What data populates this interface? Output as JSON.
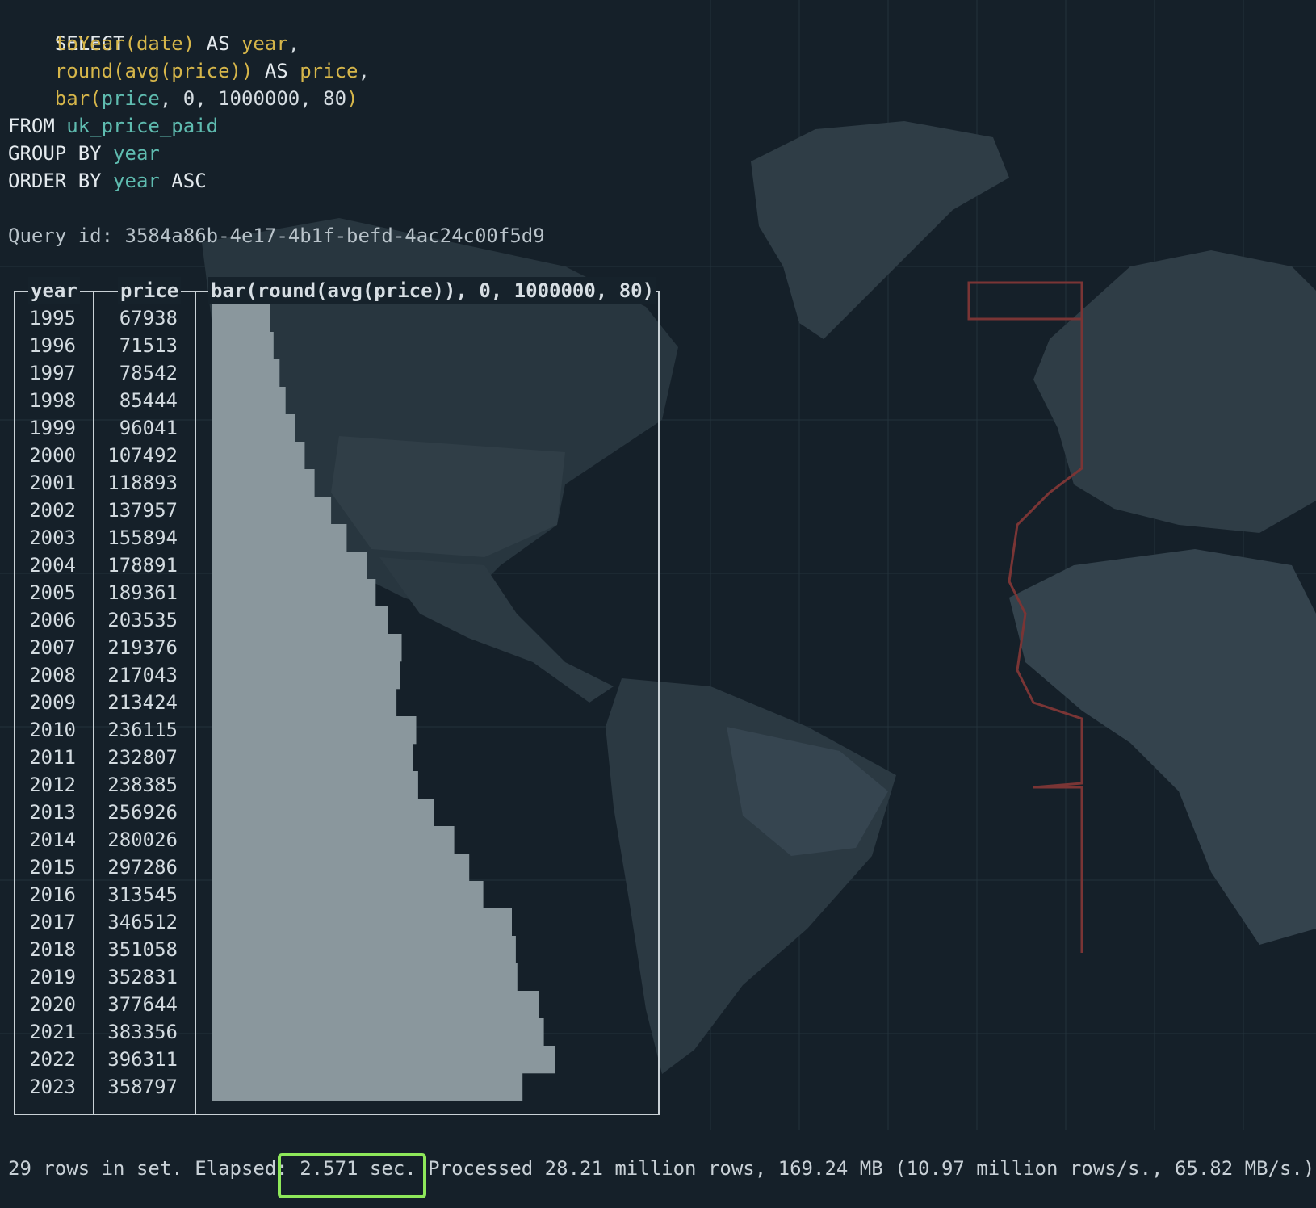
{
  "query": {
    "line1_kw": "SELECT",
    "line2_fn": "toYear(date)",
    "line2_kw": " AS ",
    "line2_id": "year",
    "line2_tail": ",",
    "line3_fn": "round(avg(price))",
    "line3_kw": " AS ",
    "line3_id": "price",
    "line3_tail": ",",
    "line4_fn": "bar(",
    "line4_id": "price",
    "line4_args": ", 0, 1000000, 80",
    "line4_close": ")",
    "line5_kw": "FROM ",
    "line5_id": "uk_price_paid",
    "line6_kw": "GROUP BY ",
    "line6_id": "year",
    "line7_kw": "ORDER BY ",
    "line7_id": "year",
    "line7_tail": " ASC",
    "query_id_label": "Query id: 3584a86b-4e17-4b1f-befd-4ac24c00f5d9"
  },
  "table": {
    "columns": [
      "year",
      "price",
      "bar(round(avg(price)), 0, 1000000, 80)"
    ],
    "rows": [
      {
        "year": "1995",
        "price": "67938"
      },
      {
        "year": "1996",
        "price": "71513"
      },
      {
        "year": "1997",
        "price": "78542"
      },
      {
        "year": "1998",
        "price": "85444"
      },
      {
        "year": "1999",
        "price": "96041"
      },
      {
        "year": "2000",
        "price": "107492"
      },
      {
        "year": "2001",
        "price": "118893"
      },
      {
        "year": "2002",
        "price": "137957"
      },
      {
        "year": "2003",
        "price": "155894"
      },
      {
        "year": "2004",
        "price": "178891"
      },
      {
        "year": "2005",
        "price": "189361"
      },
      {
        "year": "2006",
        "price": "203535"
      },
      {
        "year": "2007",
        "price": "219376"
      },
      {
        "year": "2008",
        "price": "217043"
      },
      {
        "year": "2009",
        "price": "213424"
      },
      {
        "year": "2010",
        "price": "236115"
      },
      {
        "year": "2011",
        "price": "232807"
      },
      {
        "year": "2012",
        "price": "238385"
      },
      {
        "year": "2013",
        "price": "256926"
      },
      {
        "year": "2014",
        "price": "280026"
      },
      {
        "year": "2015",
        "price": "297286"
      },
      {
        "year": "2016",
        "price": "313545"
      },
      {
        "year": "2017",
        "price": "346512"
      },
      {
        "year": "2018",
        "price": "351058"
      },
      {
        "year": "2019",
        "price": "352831"
      },
      {
        "year": "2020",
        "price": "377644"
      },
      {
        "year": "2021",
        "price": "383356"
      },
      {
        "year": "2022",
        "price": "396311"
      },
      {
        "year": "2023",
        "price": "358797"
      }
    ],
    "bar_max": 1000000,
    "bar_width_chars": 80,
    "bar_color": "#8a979d"
  },
  "status": {
    "text": "29 rows in set. Elapsed: 2.571 sec. Processed 28.21 million rows, 169.24 MB (10.97 million rows/s., 65.82 MB/s.)",
    "highlight_color": "#8ee85a"
  },
  "colors": {
    "background": "#152029",
    "keyword": "#e4eaee",
    "function": "#d6b64a",
    "identifier": "#5fbcb0"
  }
}
